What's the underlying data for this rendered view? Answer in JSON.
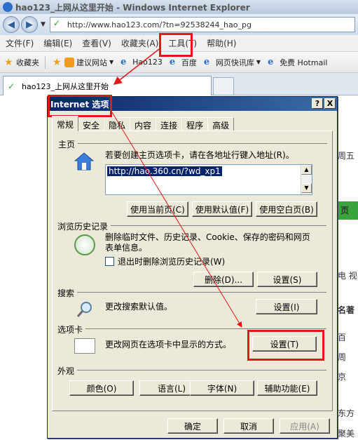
{
  "window": {
    "title": "hao123_上网从这里开始 - Windows Internet Explorer",
    "url": "http://www.hao123.com/?tn=92538244_hao_pg"
  },
  "menubar": [
    "文件(F)",
    "编辑(E)",
    "查看(V)",
    "收藏夹(A)",
    "工具(T)",
    "帮助(H)"
  ],
  "favorites_bar": {
    "favorites_label": "收藏夹",
    "items": [
      "建议网站",
      "Hao123",
      "百度",
      "网页快讯库",
      "免费 Hotmail"
    ]
  },
  "tab": {
    "title": "hao123_上网从这里开始"
  },
  "page_background": {
    "right_strip": [
      "周五",
      "页",
      "电 视",
      "名著",
      "百",
      "周",
      "京",
      "东方",
      "聚美"
    ]
  },
  "dialog": {
    "title": "Internet 选项",
    "title_buttons": [
      "?",
      "X"
    ],
    "tabs": [
      "常规",
      "安全",
      "隐私",
      "内容",
      "连接",
      "程序",
      "高级"
    ],
    "homepage": {
      "label": "主页",
      "description": "若要创建主页选项卡，请在各地址行键入地址(R)。",
      "value": "http://hao.360.cn/?wd_xp1",
      "buttons": [
        "使用当前页(C)",
        "使用默认值(F)",
        "使用空白页(B)"
      ]
    },
    "history": {
      "label": "浏览历史记录",
      "description_line1": "删除临时文件、历史记录、Cookie、保存的密码和网页",
      "description_line2": "表单信息。",
      "checkbox_label": "退出时删除浏览历史记录(W)",
      "buttons": [
        "删除(D)...",
        "设置(S)"
      ]
    },
    "search": {
      "label": "搜索",
      "description": "更改搜索默认值。",
      "button": "设置(I)"
    },
    "tabs_section": {
      "label": "选项卡",
      "description": "更改网页在选项卡中显示的方式。",
      "button": "设置(T)"
    },
    "appearance": {
      "label": "外观",
      "buttons": [
        "颜色(O)",
        "语言(L)",
        "字体(N)",
        "辅助功能(E)"
      ]
    },
    "footer_buttons": [
      "确定",
      "取消",
      "应用(A)"
    ]
  },
  "colors": {
    "annotation_red": "#e0181a",
    "dialog_bg": "#ece9d8",
    "title_blue": "#0a246a"
  }
}
